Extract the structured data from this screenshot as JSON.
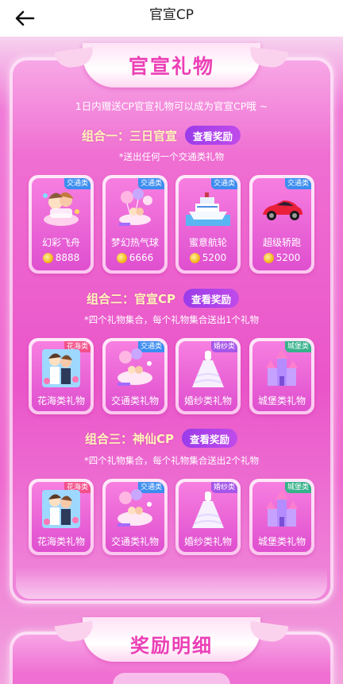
{
  "header": {
    "title": "官宣CP",
    "back_icon": "arrow-left-icon"
  },
  "section": {
    "title": "官宣礼物",
    "subtitle": "1日内赠送CP官宣礼物可以成为官宣CP哦 ~"
  },
  "combos": [
    {
      "label": "组合一：三日官宣",
      "button": "查看奖励",
      "note": "*送出任何一个交通类礼物",
      "gifts": [
        {
          "tag": "交通类",
          "name": "幻彩飞舟",
          "price": "8888",
          "icon": "flying-boat-icon"
        },
        {
          "tag": "交通类",
          "name": "梦幻热气球",
          "price": "6666",
          "icon": "hot-air-balloon-icon"
        },
        {
          "tag": "交通类",
          "name": "蜜意航轮",
          "price": "5200",
          "icon": "cruise-ship-icon"
        },
        {
          "tag": "交通类",
          "name": "超级轿跑",
          "price": "5200",
          "icon": "sports-car-icon"
        }
      ]
    },
    {
      "label": "组合二：官宣CP",
      "button": "查看奖励",
      "note": "*四个礼物集合，每个礼物集合送出1个礼物",
      "gifts": [
        {
          "tag": "花海类",
          "name": "花海类礼物",
          "icon": "couple-flowers-icon"
        },
        {
          "tag": "交通类",
          "name": "交通类礼物",
          "icon": "carriage-icon"
        },
        {
          "tag": "婚纱类",
          "name": "婚纱类礼物",
          "icon": "wedding-dress-icon"
        },
        {
          "tag": "城堡类",
          "name": "城堡类礼物",
          "icon": "castle-icon"
        }
      ]
    },
    {
      "label": "组合三：神仙CP",
      "button": "查看奖励",
      "note": "*四个礼物集合，每个礼物集合送出2个礼物",
      "gifts": [
        {
          "tag": "花海类",
          "name": "花海类礼物",
          "icon": "couple-flowers-icon"
        },
        {
          "tag": "交通类",
          "name": "交通类礼物",
          "icon": "carriage-icon"
        },
        {
          "tag": "婚纱类",
          "name": "婚纱类礼物",
          "icon": "wedding-dress-icon"
        },
        {
          "tag": "城堡类",
          "name": "城堡类礼物",
          "icon": "castle-icon"
        }
      ]
    }
  ],
  "reward_section": {
    "title": "奖励明细"
  },
  "colors": {
    "accent": "#ec3fb6",
    "button": "#a543ea",
    "combo_label": "#fff6b8"
  }
}
